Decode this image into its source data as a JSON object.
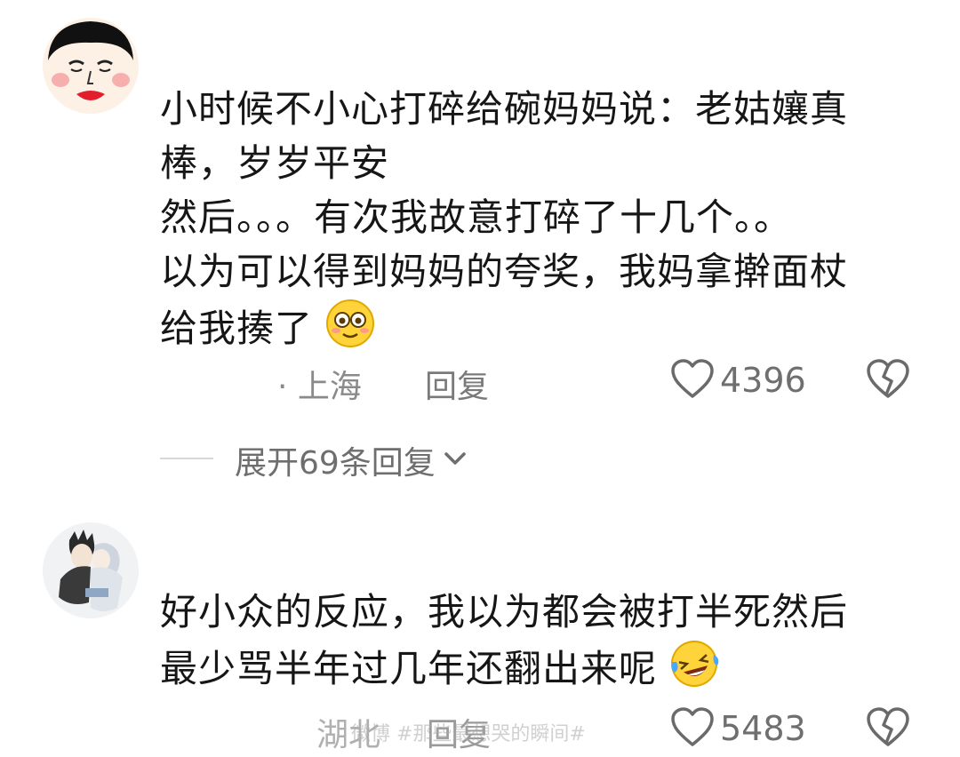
{
  "comments": [
    {
      "lines": [
        "小时候不小心打碎给碗妈妈说：老姑孃真",
        "棒，岁岁平安",
        "然后。。。有次我故意打碎了十几个。。",
        "以为可以得到妈妈的夸奖，我妈拿擀面杖",
        "给我揍了"
      ],
      "emoji": "smile-emoji",
      "location": "· 上海",
      "reply_label": "回复",
      "likes": "4396",
      "expand_label": "展开69条回复"
    },
    {
      "lines": [
        "好小众的反应，我以为都会被打半死然后",
        "最少骂半年过几年还翻出来呢"
      ],
      "emoji": "laugh-cry-emoji",
      "location": "湖北",
      "reply_label": "回复",
      "likes": "5483"
    }
  ],
  "watermark": "微博 #那些最想哭的瞬间#",
  "icons": {
    "like": "heart-outline-icon",
    "dislike": "broken-heart-icon",
    "expand": "chevron-down-icon"
  }
}
